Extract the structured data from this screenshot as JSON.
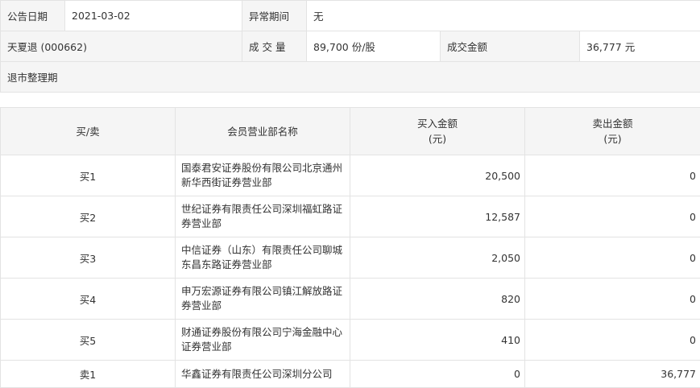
{
  "info": {
    "announce_date_label": "公告日期",
    "announce_date": "2021-03-02",
    "abnormal_period_label": "异常期间",
    "abnormal_period": "无",
    "stock_name": "天夏退 (000662)",
    "volume_label": "成 交 量",
    "volume": "89,700 份/股",
    "turnover_label": "成交金额",
    "turnover": "36,777 元",
    "reason": "退市整理期"
  },
  "trades": {
    "headers": {
      "side": "买/卖",
      "branch": "会员营业部名称",
      "buy_amount": "买入金额",
      "buy_unit": "(元)",
      "sell_amount": "卖出金额",
      "sell_unit": "(元)"
    },
    "rows": [
      {
        "side": "买1",
        "branch": "国泰君安证券股份有限公司北京通州新华西街证券营业部",
        "buy": "20,500",
        "sell": "0"
      },
      {
        "side": "买2",
        "branch": "世纪证券有限责任公司深圳福虹路证券营业部",
        "buy": "12,587",
        "sell": "0"
      },
      {
        "side": "买3",
        "branch": "中信证券（山东）有限责任公司聊城东昌东路证券营业部",
        "buy": "2,050",
        "sell": "0"
      },
      {
        "side": "买4",
        "branch": "申万宏源证券有限公司镇江解放路证券营业部",
        "buy": "820",
        "sell": "0"
      },
      {
        "side": "买5",
        "branch": "财通证券股份有限公司宁海金融中心证券营业部",
        "buy": "410",
        "sell": "0"
      },
      {
        "side": "卖1",
        "branch": "华鑫证券有限责任公司深圳分公司",
        "buy": "0",
        "sell": "36,777"
      }
    ]
  }
}
